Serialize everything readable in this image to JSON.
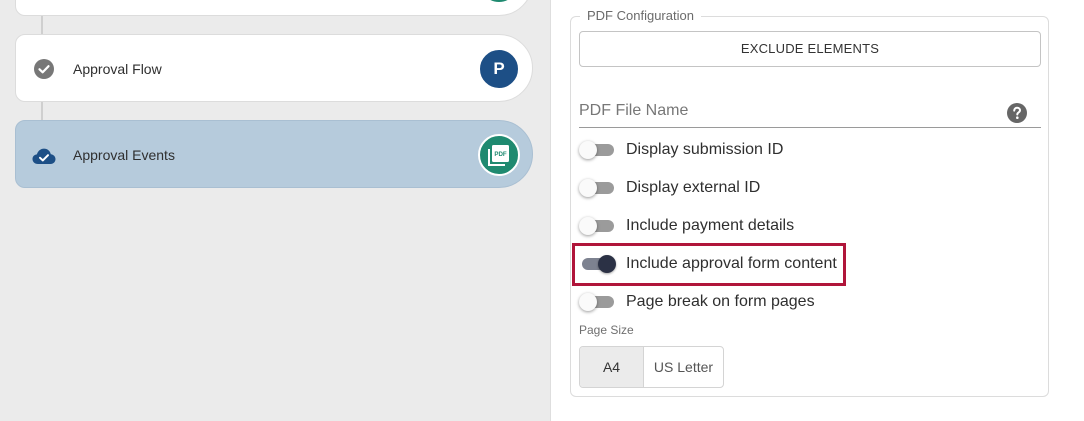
{
  "steps": [
    {
      "label": "",
      "status": "partial",
      "badge_color": "#1f8a70"
    },
    {
      "label": "Approval Flow",
      "status": "check-circle",
      "badge_text": "P",
      "badge_color": "#1d4f86"
    },
    {
      "label": "Approval Events",
      "status": "cloud-check",
      "badge_icon": "pdf-icon",
      "badge_text": "PDF",
      "badge_color": "#1f8a70",
      "active": true
    }
  ],
  "pdf_config": {
    "legend": "PDF Configuration",
    "exclude_button": "EXCLUDE ELEMENTS",
    "file_name_label": "PDF File Name",
    "toggles": [
      {
        "label": "Display submission ID",
        "on": false
      },
      {
        "label": "Display external ID",
        "on": false
      },
      {
        "label": "Include payment details",
        "on": false
      },
      {
        "label": "Include approval form content",
        "on": true
      },
      {
        "label": "Page break on form pages",
        "on": false
      }
    ],
    "page_size_label": "Page Size",
    "page_sizes": [
      "A4",
      "US Letter"
    ],
    "page_size_selected": "A4"
  },
  "colors": {
    "active_step_bg": "#b6cbdc",
    "highlight": "#b0153a",
    "toggle_on_knob": "#2b3145"
  }
}
